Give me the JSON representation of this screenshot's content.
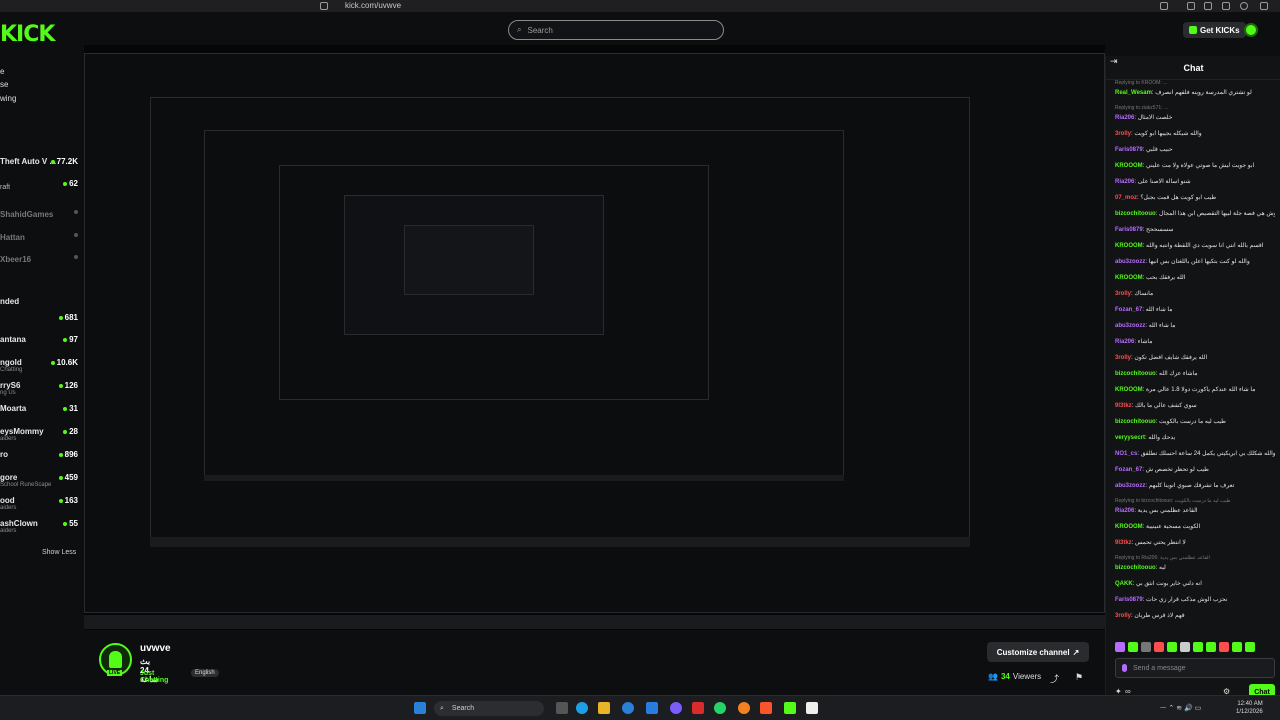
{
  "browser": {
    "url": "kick.com/uvwve"
  },
  "header": {
    "logo": "KICK",
    "search_placeholder": "Search",
    "get_kicks_label": "Get KICKs"
  },
  "sidebar": {
    "nav": [
      "e",
      "se",
      "wing"
    ],
    "recommended": [
      {
        "name": "Theft Auto V ...",
        "count": "77.2K",
        "live": true
      },
      {
        "name": "raft",
        "count": "62",
        "live": true
      },
      {
        "name": "ShahidGames",
        "count": "",
        "live": false
      },
      {
        "name": "Hattan",
        "count": "",
        "live": false
      },
      {
        "name": "Xbeer16",
        "count": "",
        "live": false
      }
    ],
    "section_label": "nded",
    "following": [
      {
        "name": "",
        "sub": "",
        "count": "681"
      },
      {
        "name": "antana",
        "sub": "",
        "count": "97"
      },
      {
        "name": "ngold",
        "sub": "Chatting",
        "count": "10.6K"
      },
      {
        "name": "rryS6",
        "sub": "ng Us",
        "count": "126"
      },
      {
        "name": "Moarta",
        "sub": "",
        "count": "31"
      },
      {
        "name": "eysMommy",
        "sub": "aiders",
        "count": "28"
      },
      {
        "name": "ro",
        "sub": "",
        "count": "896"
      },
      {
        "name": "gore",
        "sub": "School RuneScape",
        "count": "459"
      },
      {
        "name": "ood",
        "sub": "aiders",
        "count": "163"
      },
      {
        "name": "ashClown",
        "sub": "aiders",
        "count": "55"
      }
    ],
    "show_less": "Show Less"
  },
  "stream": {
    "streamer_name": "uvwve",
    "title": "بث 24 ساعة",
    "category": "Just Chatting",
    "language": "English",
    "live_badge": "LIVE",
    "customize_label": "Customize channel",
    "viewers_count": "34",
    "viewers_label": "Viewers"
  },
  "chat": {
    "title": "Chat",
    "messages": [
      {
        "reply": "Replying to KROOM: ...",
        "user": "Real_Wesam",
        "color": "#53fc18",
        "text": "لو تشتري المدرسة روينه فلقهم انصرف"
      },
      {
        "reply": "Replying to ziakz571: ...",
        "user": "",
        "color": "",
        "text": ""
      },
      {
        "reply": "",
        "user": "Ria206",
        "color": "#b86cff",
        "text": "خلصت الامثال"
      },
      {
        "reply": "",
        "user": "3rolly",
        "color": "#ff4d4d",
        "text": "والله شيكله بجيبها ابو كويت"
      },
      {
        "reply": "",
        "user": "Faris0879",
        "color": "#b86cff",
        "text": "حبيب قلبي"
      },
      {
        "reply": "",
        "user": "KROOOM",
        "color": "#53fc18",
        "text": "ابو جويت ليش ما صوتي عولاة ولا مت عليني"
      },
      {
        "reply": "",
        "user": "Ria206",
        "color": "#b86cff",
        "text": "شنو اسالة الاصنا على"
      },
      {
        "reply": "",
        "user": "07_moz",
        "color": "#ff4d4d",
        "text": "طيب ابو كويت هل قمت بجبل؟"
      },
      {
        "reply": "",
        "user": "bizcochitoouo",
        "color": "#53fc18",
        "text": "وش هي قصة جلة لبيها التقصيص ابن هذا المجال"
      },
      {
        "reply": "",
        "user": "Faris0879",
        "color": "#b86cff",
        "text": "سسسححح"
      },
      {
        "reply": "",
        "user": "KROOOM",
        "color": "#53fc18",
        "text": "اقسم بالله انتي انا سويت دي اللقطة وانتبه والله"
      },
      {
        "reply": "",
        "user": "abu3zoozz",
        "color": "#b86cff",
        "text": "والله لو كنت بتكيها اعلن باللغتان بس انيها"
      },
      {
        "reply": "",
        "user": "KROOOM",
        "color": "#53fc18",
        "text": "الله يرفقك بحب"
      },
      {
        "reply": "",
        "user": "3rolly",
        "color": "#ff4d4d",
        "text": "مانساك"
      },
      {
        "reply": "",
        "user": "Fozan_67",
        "color": "#b86cff",
        "text": "ما شاء الله"
      },
      {
        "reply": "",
        "user": "abu3zoozz",
        "color": "#b86cff",
        "text": "ما شاء الله"
      },
      {
        "reply": "",
        "user": "Ria206",
        "color": "#b86cff",
        "text": "ماشاء"
      },
      {
        "reply": "",
        "user": "3rolly",
        "color": "#ff4d4d",
        "text": "الله يرفقك شايف افضل تكون"
      },
      {
        "reply": "",
        "user": "bizcochitoouo",
        "color": "#53fc18",
        "text": "ماشاء عزك الله"
      },
      {
        "reply": "",
        "user": "KROOOM",
        "color": "#53fc18",
        "text": "ما شاء الله عندكم ياكورت دولا 1.8 عالي مرة"
      },
      {
        "reply": "",
        "user": "9l3tkz",
        "color": "#ff4d4d",
        "text": "سوي كشف عالي ما بالك"
      },
      {
        "reply": "",
        "user": "bizcochitoouo",
        "color": "#53fc18",
        "text": "طيب ليه ما درست بالكويت"
      },
      {
        "reply": "",
        "user": "veryysecrt",
        "color": "#53fc18",
        "text": "يدحك والله"
      },
      {
        "reply": "",
        "user": "NO1_cs",
        "color": "#b86cff",
        "text": "والله شكلك بي ابريكيتي يكمل 24 ساعة احسلك تطلقق"
      },
      {
        "reply": "",
        "user": "Fozan_67",
        "color": "#b86cff",
        "text": "طيب لو تحظر تخصص ش"
      },
      {
        "reply": "",
        "user": "abu3zoozz",
        "color": "#b86cff",
        "text": "تعرف ما تشرفك صبوي انوينا كلبهم"
      },
      {
        "reply": "Replying to bizcochitoouo: طيب ليه ما درست بالكويت",
        "user": "Ria206",
        "color": "#b86cff",
        "text": "القاعد عظلمني بس يدية"
      },
      {
        "reply": "",
        "user": "KROOOM",
        "color": "#53fc18",
        "text": "الكويت مسحية عنينيية"
      },
      {
        "reply": "",
        "user": "9l3tkz",
        "color": "#ff4d4d",
        "text": "لا انتظر يحتي تحمس"
      },
      {
        "reply": "Replying to Ria206: القاعد عظلمني بس يدية",
        "user": "bizcochitoouo",
        "color": "#53fc18",
        "text": "ليه"
      },
      {
        "reply": "",
        "user": "QAKK",
        "color": "#53fc18",
        "text": "انه دلني خاير بونت انثق بي"
      },
      {
        "reply": "",
        "user": "Faris0879",
        "color": "#b86cff",
        "text": "نحزب الوش مذكب قرار زي حات"
      },
      {
        "reply": "",
        "user": "3rolly",
        "color": "#ff4d4d",
        "text": "قهم لاذ قرس طريان"
      }
    ],
    "input_placeholder": "Send a message",
    "send_label": "Chat"
  },
  "taskbar": {
    "search_label": "Search",
    "time": "12:40 AM",
    "date": "1/12/2026"
  }
}
